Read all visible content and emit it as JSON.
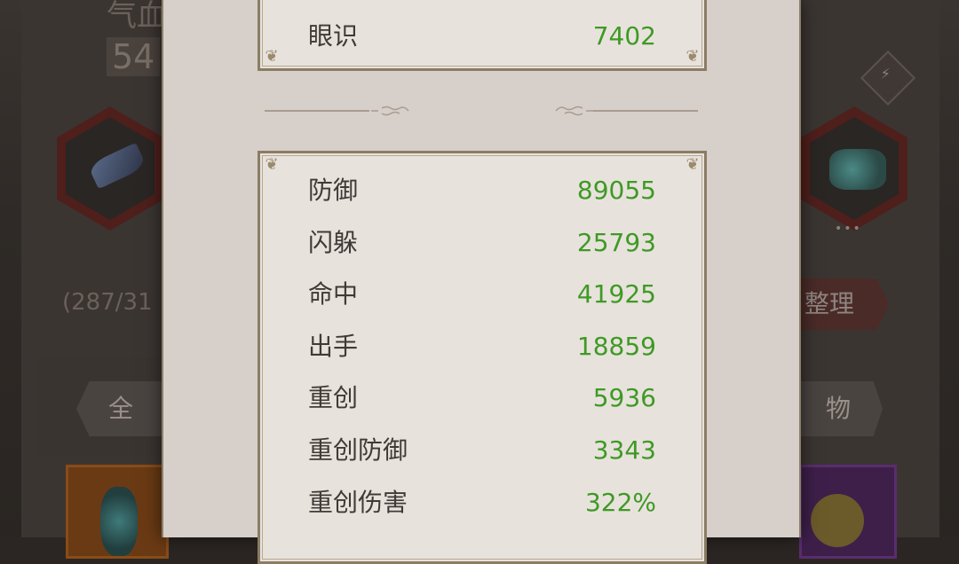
{
  "background": {
    "title_char": "气血",
    "power_value": "54",
    "bag_count": "(287/31",
    "organize_label": "整理",
    "tab_left": "全",
    "tab_right": "物",
    "more_dots": "•••"
  },
  "panel": {
    "top_stats": [
      {
        "name": "眼识",
        "value": "7402"
      }
    ],
    "stats": [
      {
        "name": "防御",
        "value": "89055"
      },
      {
        "name": "闪躲",
        "value": "25793"
      },
      {
        "name": "命中",
        "value": "41925"
      },
      {
        "name": "出手",
        "value": "18859"
      },
      {
        "name": "重创",
        "value": "5936"
      },
      {
        "name": "重创防御",
        "value": "3343"
      },
      {
        "name": "重创伤害",
        "value": "322%"
      }
    ]
  },
  "colors": {
    "stat_value": "#3e9a24",
    "stat_name": "#403a37",
    "card_border": "#8b7d63",
    "panel_bg": "#d7cfca"
  },
  "icons": {
    "weapon": "sword-icon",
    "mount": "beast-icon",
    "swap": "lightning-icon"
  }
}
